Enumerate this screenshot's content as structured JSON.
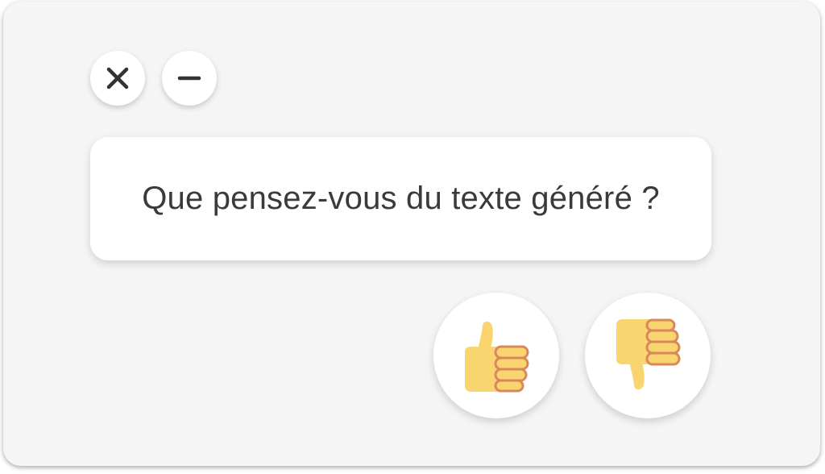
{
  "window": {
    "close_icon": "close-icon",
    "minimize_icon": "minimize-icon"
  },
  "prompt": {
    "question": "Que pensez-vous du texte généré ?"
  },
  "feedback": {
    "thumbs_up_icon": "thumbs-up-icon",
    "thumbs_down_icon": "thumbs-down-icon"
  },
  "colors": {
    "panel_background": "#f5f5f5",
    "card_background": "#ffffff",
    "text": "#3a3a3a",
    "icon_dark": "#333333",
    "thumb_fill": "#f9d56f",
    "thumb_outline": "#d9885a"
  }
}
